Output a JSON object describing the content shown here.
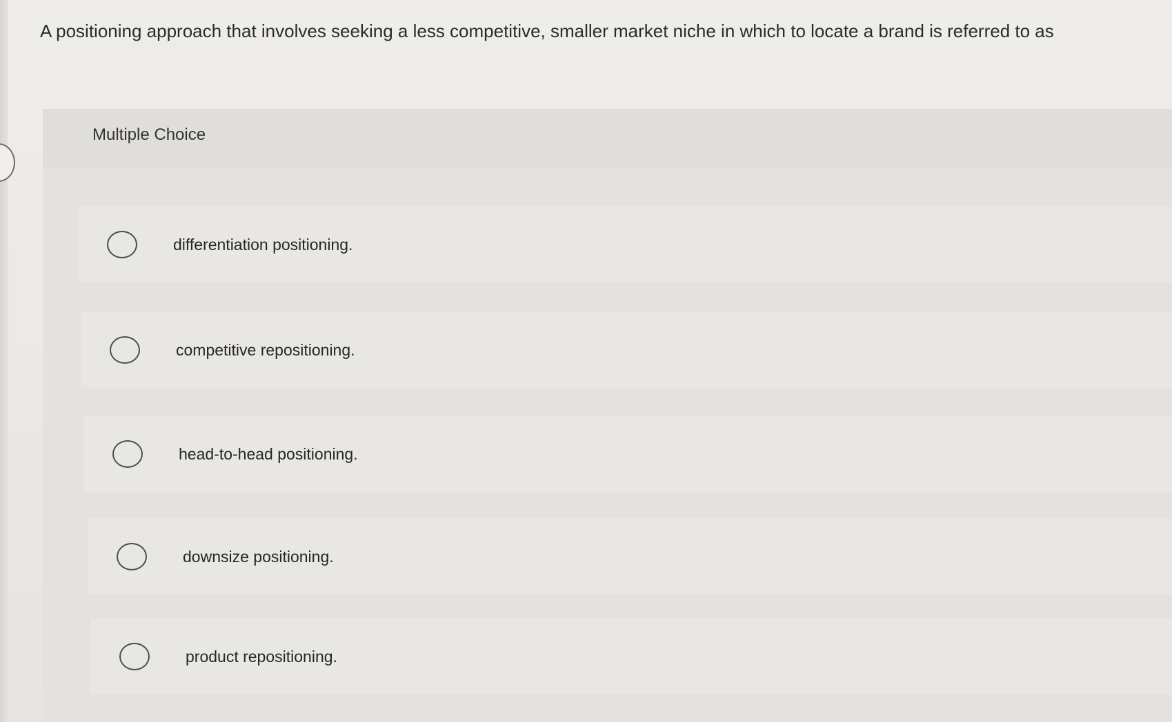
{
  "question": {
    "text": "A positioning approach that involves seeking a less competitive, smaller market niche in which to locate a brand is referred to as"
  },
  "quiz": {
    "type_label": "Multiple Choice",
    "options": [
      {
        "label": "differentiation positioning."
      },
      {
        "label": "competitive repositioning."
      },
      {
        "label": "head-to-head positioning."
      },
      {
        "label": "downsize positioning."
      },
      {
        "label": "product repositioning."
      }
    ]
  },
  "colors": {
    "background": "#ebe9e5",
    "panel": "#e4e2de",
    "option_bg": "#e9e7e3",
    "text": "#2a2a2a",
    "radio_border": "#4d4d4d"
  }
}
